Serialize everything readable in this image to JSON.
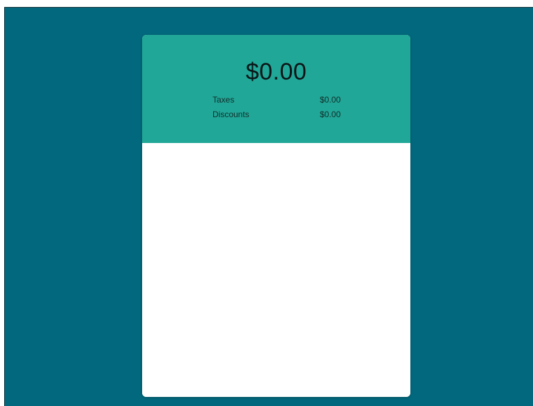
{
  "summary": {
    "total": "$0.00",
    "rows": [
      {
        "label": "Taxes",
        "value": "$0.00"
      },
      {
        "label": "Discounts",
        "value": "$0.00"
      }
    ]
  },
  "colors": {
    "background": "#02687d",
    "header": "#21a797",
    "card": "#ffffff"
  }
}
